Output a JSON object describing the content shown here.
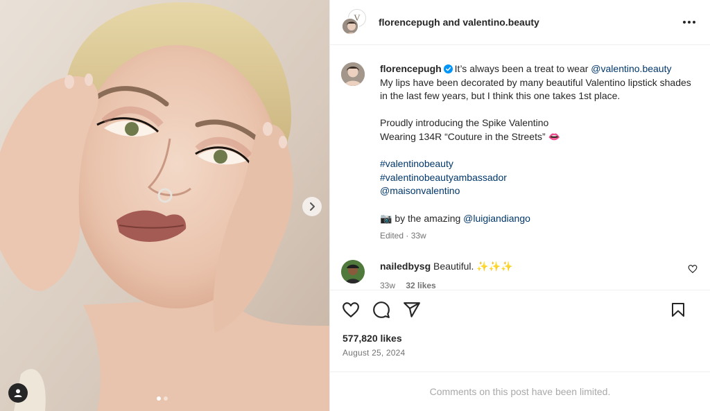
{
  "colors": {
    "link": "#00376b",
    "text": "#262626",
    "muted": "#737373",
    "verified": "#0095f6",
    "footer_text": "#a8a8a8"
  },
  "media": {
    "next_icon": "chevron-right-icon",
    "tag_icon": "user-tag-icon",
    "carousel": {
      "total": 2,
      "current": 1
    }
  },
  "header": {
    "user": "florencepugh",
    "connector": "and",
    "collaborator": "valentino.beauty",
    "brand_mark": "V",
    "more_icon": "more-horizontal-icon"
  },
  "caption": {
    "user": "florencepugh",
    "line1": "It’s always been a treat to wear ",
    "mention1": "@valentino.beauty",
    "line2": "My lips have been decorated by many beautiful Valentino lipstick shades in the last few years, but I think this one takes 1st place.",
    "line3": "Proudly introducing the Spike Valentino",
    "line4": "Wearing 134R “Couture in the Streets” 👄",
    "hashtag1": "#valentinobeauty",
    "hashtag2": "#valentinobeautyambassador",
    "mention2": "@maisonvalentino",
    "credit_prefix": "📷 by the amazing ",
    "mention3": "@luigiandiango",
    "meta": "Edited · 33w"
  },
  "comment": {
    "user": "nailedbysg",
    "text": "Beautiful. ✨✨✨",
    "age": "33w",
    "likes": "32 likes"
  },
  "actions": {
    "like_icon": "heart-icon",
    "comment_icon": "comment-icon",
    "share_icon": "share-icon",
    "save_icon": "bookmark-icon"
  },
  "likes_count": "577,820 likes",
  "date": "August 25, 2024",
  "footer": {
    "text": "Comments on this post have been limited."
  }
}
